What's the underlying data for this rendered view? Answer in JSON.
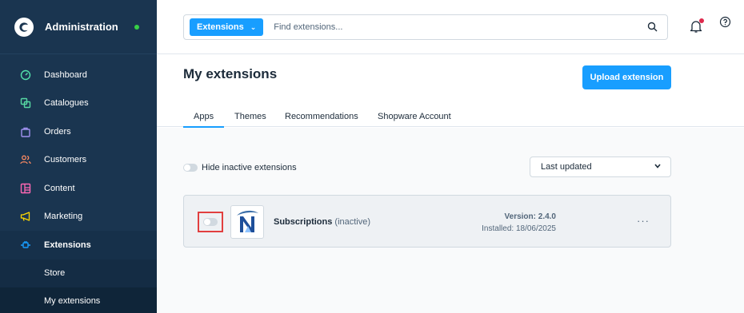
{
  "sidebar": {
    "title": "Administration",
    "items": [
      {
        "label": "Dashboard",
        "icon": "gauge-icon",
        "color": "#52e1ab"
      },
      {
        "label": "Catalogues",
        "icon": "copy-icon",
        "color": "#57d9a3"
      },
      {
        "label": "Orders",
        "icon": "shopping-bag-icon",
        "color": "#a092f0"
      },
      {
        "label": "Customers",
        "icon": "users-icon",
        "color": "#f88962"
      },
      {
        "label": "Content",
        "icon": "content-icon",
        "color": "#ff68b4"
      },
      {
        "label": "Marketing",
        "icon": "megaphone-icon",
        "color": "#ffd700"
      },
      {
        "label": "Extensions",
        "icon": "plug-icon",
        "color": "#189eff"
      }
    ],
    "subitems": [
      {
        "label": "Store"
      },
      {
        "label": "My extensions"
      }
    ]
  },
  "header": {
    "search_type": "Extensions",
    "search_placeholder": "Find extensions..."
  },
  "page": {
    "title": "My extensions",
    "upload_label": "Upload extension",
    "tabs": [
      {
        "label": "Apps"
      },
      {
        "label": "Themes"
      },
      {
        "label": "Recommendations"
      },
      {
        "label": "Shopware Account"
      }
    ],
    "hide_inactive_label": "Hide inactive extensions",
    "sort_value": "Last updated"
  },
  "extension": {
    "name": "Subscriptions",
    "status": "(inactive)",
    "version": "Version: 2.4.0",
    "installed": "Installed: 18/06/2025",
    "more": "···"
  },
  "colors": {
    "sidebar_bg": "#1a3550",
    "accent": "#189eff",
    "highlight": "#e13f3f"
  }
}
